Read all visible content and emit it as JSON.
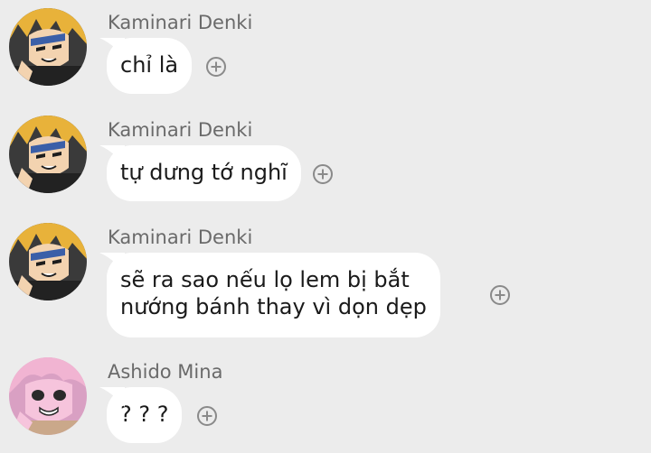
{
  "messages": [
    {
      "sender": "Kaminari Denki",
      "avatar_icon": "kaminari-avatar",
      "lines": [
        "chỉ là"
      ]
    },
    {
      "sender": "Kaminari Denki",
      "avatar_icon": "kaminari-avatar",
      "lines": [
        "tự dưng tớ nghĩ"
      ]
    },
    {
      "sender": "Kaminari Denki",
      "avatar_icon": "kaminari-avatar",
      "lines": [
        "sẽ ra sao nếu lọ lem bị bắt",
        "nướng bánh thay vì dọn dẹp"
      ]
    },
    {
      "sender": "Ashido Mina",
      "avatar_icon": "ashido-avatar",
      "lines": [
        "? ? ?"
      ]
    }
  ],
  "reaction_icon": "add-reaction-icon",
  "colors": {
    "background": "#ececec",
    "bubble": "#ffffff",
    "sender_text": "#6a6a6a",
    "message_text": "#1a1a1a",
    "icon": "#8a8a8a"
  }
}
